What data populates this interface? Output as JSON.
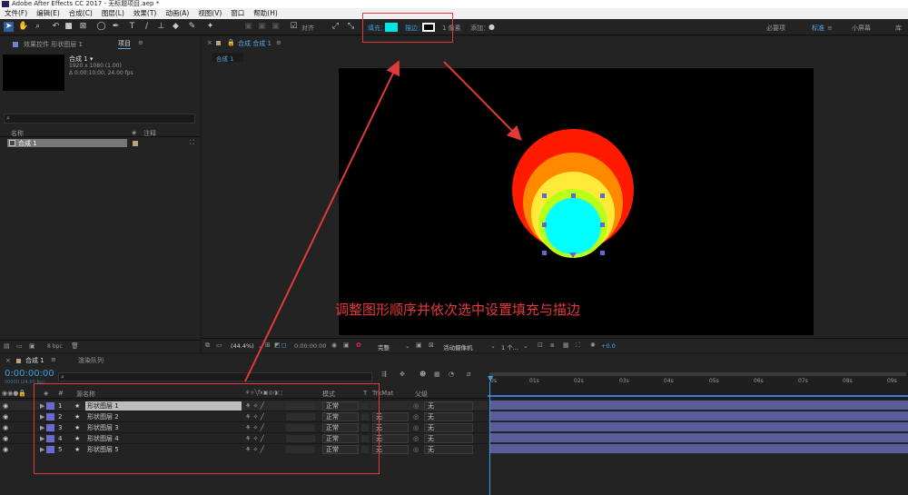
{
  "app": {
    "title": "Adobe After Effects CC 2017 - 无标题项目.aep *"
  },
  "menu": [
    "文件(F)",
    "编辑(E)",
    "合成(C)",
    "图层(L)",
    "效果(T)",
    "动画(A)",
    "视图(V)",
    "窗口",
    "帮助(H)"
  ],
  "toolbar": {
    "snap_label": "对齐",
    "fill_label": "填充：",
    "fill_color": "#00e5e5",
    "stroke_label": "描边：",
    "stroke_width": "1 像素",
    "add_label": "添加：",
    "workspaces": [
      "必要项",
      "标准",
      "小屏幕",
      "库"
    ],
    "active_workspace": "标准"
  },
  "project_panel": {
    "tab_effects": "效果控件 形状图层 1",
    "tab_project": "项目",
    "comp_name": "合成 1 ▾",
    "comp_res": "1920 x 1080 (1.00)",
    "comp_dur": "Δ 0:00:10:00, 24.00 fps",
    "col_name": "名称",
    "col_comment": "注释",
    "item": "合成 1",
    "bpc": "8 bpc"
  },
  "comp_panel": {
    "tab": "合成 合成 1",
    "subtab": "合成 1",
    "zoom": "(44.4%)",
    "timecode": "0:00:00:00",
    "resolution": "完整",
    "camera": "活动摄像机",
    "views": "1 个...",
    "exposure": "+0.0"
  },
  "annotation": "调整图形顺序并依次选中设置填充与描边",
  "timeline": {
    "tab": "合成 1",
    "render_tab": "渲染队列",
    "timecode": "0:00:00:00",
    "fps_label": "00000 (24.00 fps)",
    "col_name": "源名称",
    "col_mode": "模式",
    "col_t": "T",
    "col_trkmat": "TrkMat",
    "col_parent": "父级",
    "ruler": [
      "0s",
      "01s",
      "02s",
      "03s",
      "04s",
      "05s",
      "06s",
      "07s",
      "08s",
      "09s"
    ],
    "layers": [
      {
        "num": "1",
        "name": "形状图层 1",
        "mode": "正常",
        "trkmat": "",
        "parent": "无",
        "color": "#6a6ad0"
      },
      {
        "num": "2",
        "name": "形状图层 2",
        "mode": "正常",
        "trkmat": "无",
        "parent": "无",
        "color": "#6a6ad0"
      },
      {
        "num": "3",
        "name": "形状图层 3",
        "mode": "正常",
        "trkmat": "无",
        "parent": "无",
        "color": "#6a6ad0"
      },
      {
        "num": "4",
        "name": "形状图层 4",
        "mode": "正常",
        "trkmat": "无",
        "parent": "无",
        "color": "#6a6ad0"
      },
      {
        "num": "5",
        "name": "形状图层 5",
        "mode": "正常",
        "trkmat": "无",
        "parent": "无",
        "color": "#6a6ad0"
      }
    ]
  },
  "shapes": [
    {
      "name": "red-circle",
      "color": "#ff1a00"
    },
    {
      "name": "orange-circle",
      "color": "#ff8a00"
    },
    {
      "name": "yellow-circle",
      "color": "#ffea3a"
    },
    {
      "name": "green-circle",
      "color": "#b8ff1a"
    },
    {
      "name": "cyan-circle",
      "color": "#00ffff"
    }
  ]
}
